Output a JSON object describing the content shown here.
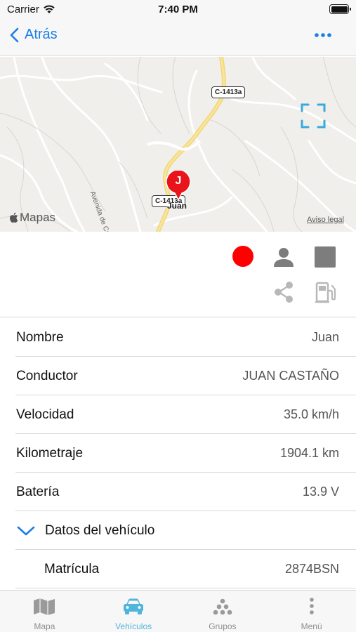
{
  "status_bar": {
    "carrier": "Carrier",
    "time": "7:40 PM"
  },
  "nav": {
    "back_label": "Atrás",
    "more_icon": "ellipsis-icon",
    "accent": "#1a7ee8"
  },
  "map": {
    "brand": "Mapas",
    "legal": "Aviso legal",
    "street_name": "Avenida de Can Canyameres",
    "road_labels": [
      "C-1413a",
      "C-1413a"
    ],
    "pin": {
      "letter": "J",
      "label": "Juan",
      "color": "#e8131b"
    }
  },
  "actions": {
    "status_color": "#ff0000",
    "icons": [
      "status-dot",
      "driver-icon",
      "stop-icon",
      "share-icon",
      "fuel-icon"
    ]
  },
  "details": [
    {
      "label": "Nombre",
      "value": "Juan"
    },
    {
      "label": "Conductor",
      "value": "JUAN CASTAÑO"
    },
    {
      "label": "Velocidad",
      "value": "35.0 km/h"
    },
    {
      "label": "Kilometraje",
      "value": "1904.1 km"
    },
    {
      "label": "Batería",
      "value": "13.9 V"
    }
  ],
  "vehicle_section": {
    "title": "Datos del vehículo",
    "rows": [
      {
        "label": "Matrícula",
        "value": "2874BSN"
      }
    ]
  },
  "tabs": [
    {
      "label": "Mapa",
      "icon": "map-icon",
      "active": false
    },
    {
      "label": "Vehículos",
      "icon": "car-icon",
      "active": true
    },
    {
      "label": "Grupos",
      "icon": "groups-icon",
      "active": false
    },
    {
      "label": "Menú",
      "icon": "menu-dots-icon",
      "active": false
    }
  ],
  "colors": {
    "tab_active": "#4fb5db",
    "tab_inactive": "#8e8e93"
  }
}
